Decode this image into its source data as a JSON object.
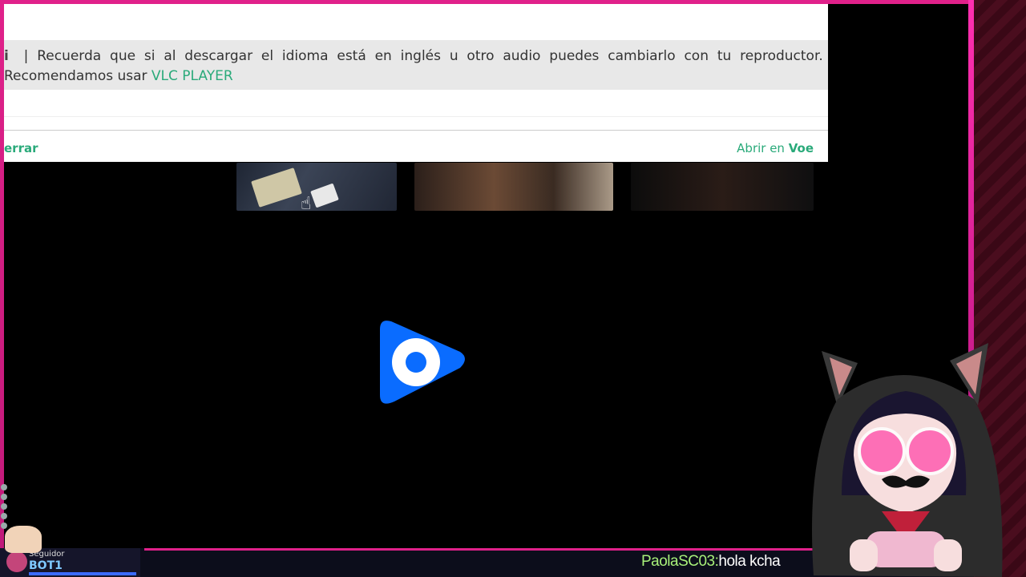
{
  "popup": {
    "notice_icon": "i",
    "notice_words": [
      "|",
      "Recuerda",
      "que",
      "si",
      "al",
      "descargar",
      "el",
      "idioma",
      "está",
      "en",
      "inglés",
      "u",
      "otro",
      "audio",
      "puedes",
      "cambiarlo",
      "con",
      "tu",
      "reproductor."
    ],
    "notice_line2_text": "Recomendamos usar ",
    "notice_link": "VLC PLAYER",
    "close_label": "errar",
    "open_label_prefix": "Abrir en ",
    "open_label_target": "Voe"
  },
  "player": {
    "play_icon": "play-logo-icon",
    "accent": "#0a6cff"
  },
  "stream": {
    "follower_label": "Seguidor",
    "follower_name": "BOT1",
    "chat_user": "PaolaSC03:",
    "chat_text": "hola kcha"
  },
  "colors": {
    "frame": "#e0218a",
    "link": "#2aaa7a",
    "chat_user": "#a8f07a"
  }
}
